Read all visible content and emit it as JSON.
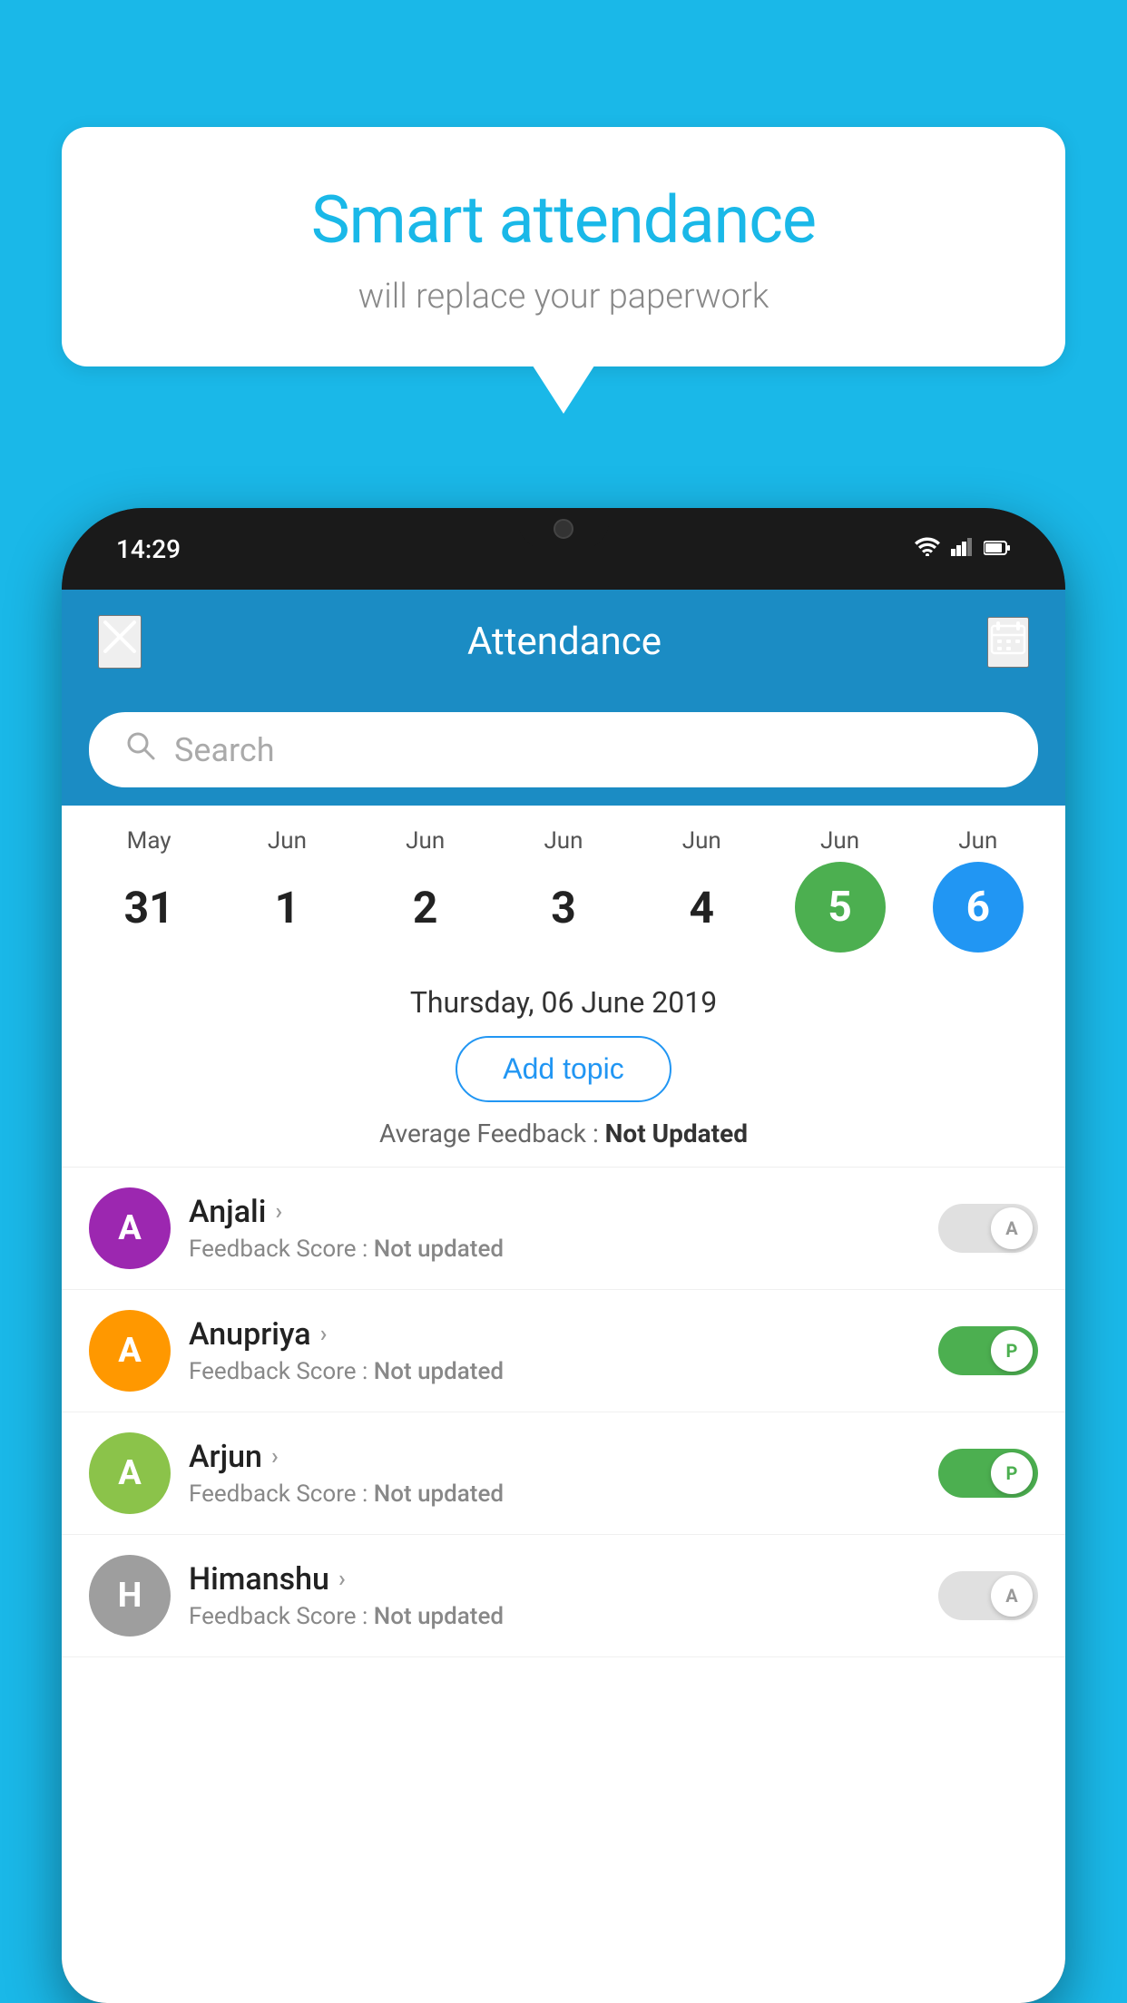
{
  "background_color": "#1ab8e8",
  "speech_bubble": {
    "title": "Smart attendance",
    "subtitle": "will replace your paperwork"
  },
  "status_bar": {
    "time": "14:29",
    "wifi": "▼",
    "signal": "▲",
    "battery": "▌"
  },
  "app_header": {
    "close_label": "×",
    "title": "Attendance",
    "calendar_icon": "📅"
  },
  "search": {
    "placeholder": "Search"
  },
  "dates": [
    {
      "month": "May",
      "day": "31",
      "style": "normal"
    },
    {
      "month": "Jun",
      "day": "1",
      "style": "normal"
    },
    {
      "month": "Jun",
      "day": "2",
      "style": "normal"
    },
    {
      "month": "Jun",
      "day": "3",
      "style": "normal"
    },
    {
      "month": "Jun",
      "day": "4",
      "style": "normal"
    },
    {
      "month": "Jun",
      "day": "5",
      "style": "green"
    },
    {
      "month": "Jun",
      "day": "6",
      "style": "blue"
    }
  ],
  "selected_date": {
    "display": "Thursday, 06 June 2019",
    "add_topic_label": "Add topic",
    "feedback_prefix": "Average Feedback : ",
    "feedback_value": "Not Updated"
  },
  "students": [
    {
      "name": "Anjali",
      "avatar_letter": "A",
      "avatar_color": "purple",
      "feedback_prefix": "Feedback Score : ",
      "feedback_value": "Not updated",
      "toggle": "off",
      "toggle_letter": "A"
    },
    {
      "name": "Anupriya",
      "avatar_letter": "A",
      "avatar_color": "orange",
      "feedback_prefix": "Feedback Score : ",
      "feedback_value": "Not updated",
      "toggle": "on",
      "toggle_letter": "P"
    },
    {
      "name": "Arjun",
      "avatar_letter": "A",
      "avatar_color": "lightgreen",
      "feedback_prefix": "Feedback Score : ",
      "feedback_value": "Not updated",
      "toggle": "on",
      "toggle_letter": "P"
    },
    {
      "name": "Himanshu",
      "avatar_letter": "H",
      "avatar_color": "teal",
      "feedback_prefix": "Feedback Score : ",
      "feedback_value": "Not updated",
      "toggle": "off",
      "toggle_letter": "A"
    }
  ]
}
